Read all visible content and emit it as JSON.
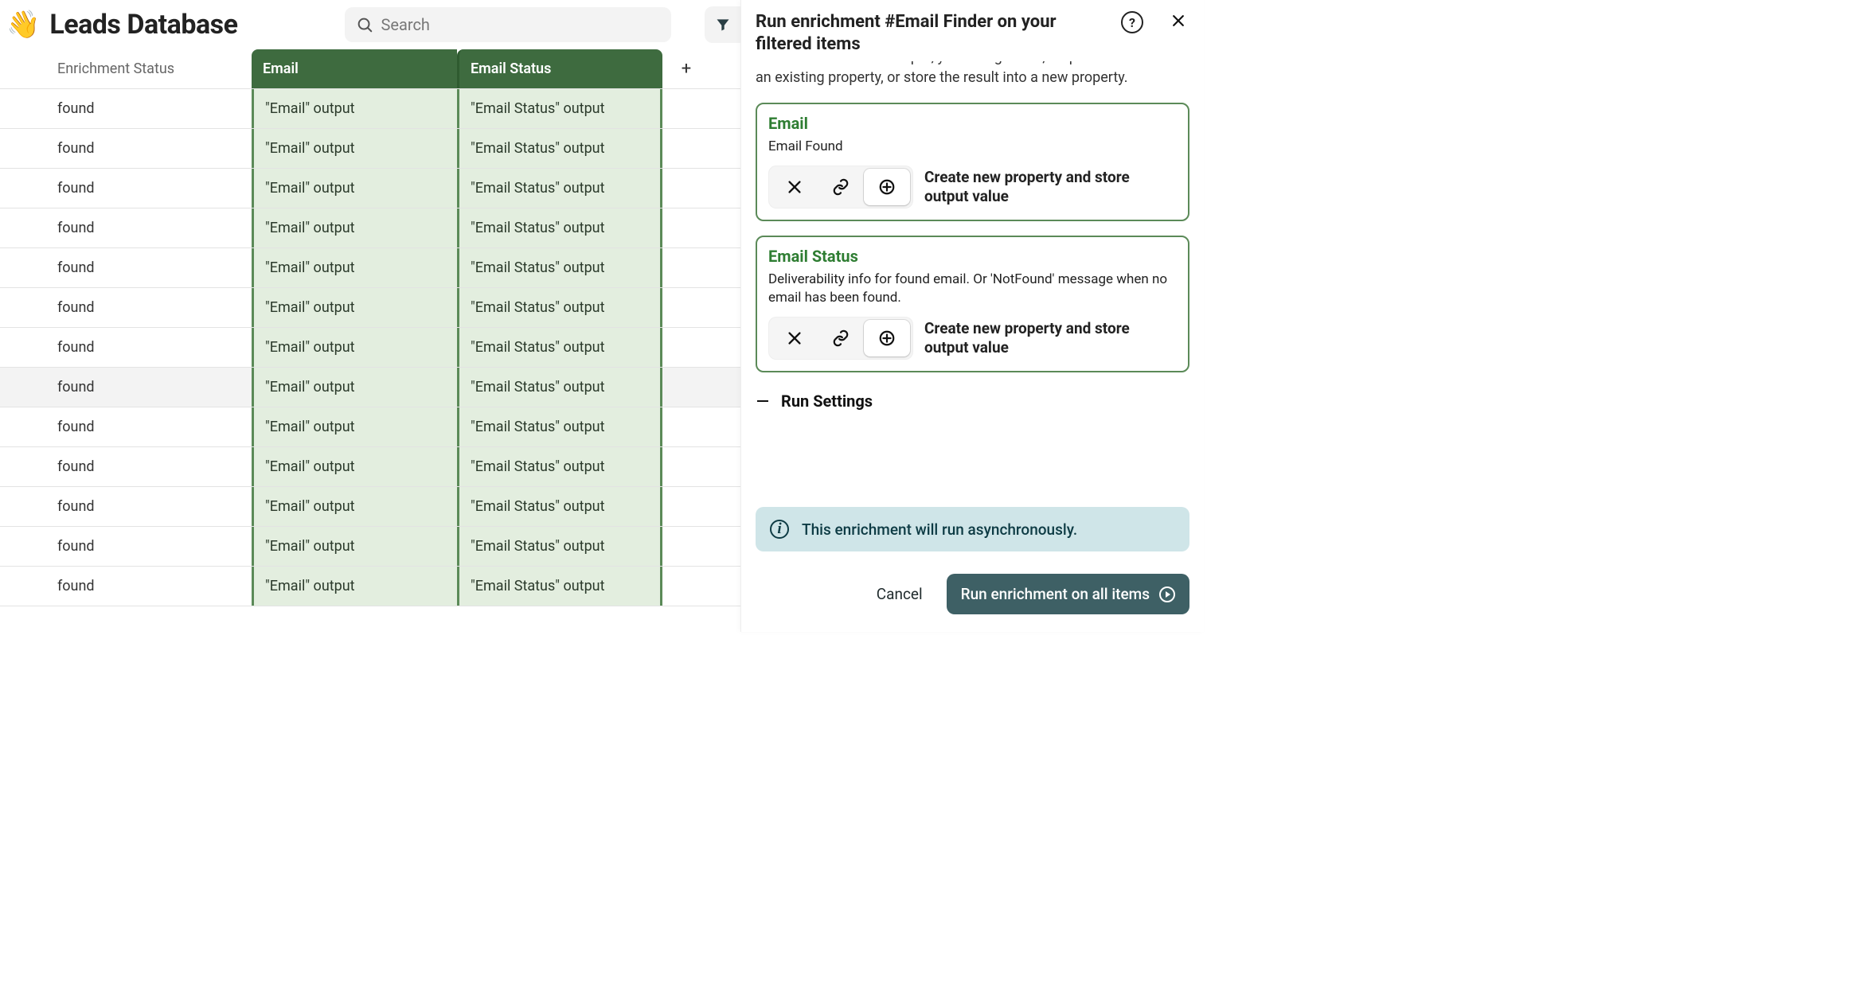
{
  "header": {
    "emoji": "👋",
    "title": "Leads Database",
    "search_placeholder": "Search"
  },
  "table": {
    "columns": {
      "status": "Enrichment Status",
      "email": "Email",
      "email_status": "Email Status"
    },
    "email_cell_text": "\"Email\" output",
    "email_status_cell_text": "\"Email Status\" output",
    "rows": [
      {
        "status": "found"
      },
      {
        "status": "found"
      },
      {
        "status": "found"
      },
      {
        "status": "found"
      },
      {
        "status": "found"
      },
      {
        "status": "found"
      },
      {
        "status": "found"
      },
      {
        "status": "found",
        "hover": true
      },
      {
        "status": "found"
      },
      {
        "status": "found"
      },
      {
        "status": "found"
      },
      {
        "status": "found"
      },
      {
        "status": "found"
      }
    ]
  },
  "panel": {
    "title": "Run enrichment #Email Finder on your filtered items",
    "intro_cut": "For each enrichment output, you can ignore it, map the result with an existing property, or store the result into a new property.",
    "outputs": [
      {
        "name": "Email",
        "desc": "Email Found",
        "selected": "plus",
        "selected_label": "Create new property and store output value"
      },
      {
        "name": "Email Status",
        "desc": "Deliverability info for found email. Or 'NotFound' message when no email has been found.",
        "selected": "plus",
        "selected_label": "Create new property and store output value"
      }
    ],
    "settings_label": "Run Settings",
    "info_text": "This enrichment will run asynchronously.",
    "cancel_label": "Cancel",
    "run_label": "Run enrichment on all items"
  }
}
